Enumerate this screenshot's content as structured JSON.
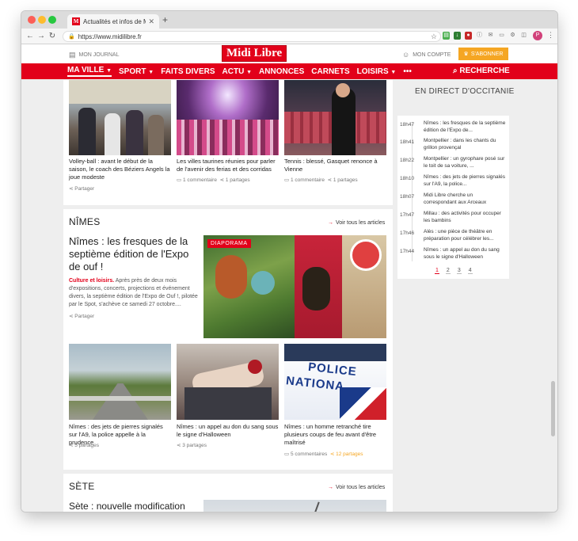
{
  "browser": {
    "tab_title": "Actualités et infos de Montpellier",
    "url": "https://www.midilibre.fr",
    "profile_initial": "P"
  },
  "header": {
    "mon_journal": "MON JOURNAL",
    "logo": "Midi Libre",
    "mon_compte": "MON COMPTE",
    "abonner": "S'ABONNER"
  },
  "nav": {
    "items": [
      "MA VILLE",
      "SPORT",
      "FAITS DIVERS",
      "ACTU",
      "ANNONCES",
      "CARNETS",
      "LOISIRS",
      "•••"
    ],
    "search": "RECHERCHE"
  },
  "top_articles": [
    {
      "title": "Volley-ball : avant le début de la saison, le coach des Béziers Angels la joue modeste",
      "share": "Partager"
    },
    {
      "title": "Les villes taurines réunies pour parler de l'avenir des ferias et des corridas",
      "comments": "1 commentaire",
      "shares": "1 partages"
    },
    {
      "title": "Tennis : blessé, Gasquet renonce à Vienne",
      "comments": "1 commentaire",
      "shares": "1 partages"
    }
  ],
  "nimes": {
    "section": "NÎMES",
    "voir": "Voir tous les articles",
    "lead_title": "Nîmes : les fresques de la septième édition de l'Expo de ouf !",
    "lead_category": "Culture et loisirs.",
    "lead_text": " Après près de deux mois d'expositions, concerts, projections et événement divers, la septième édition de l'Expo de Ouf !, pilotée par le Spot, s'achève ce samedi 27 octobre....",
    "lead_share": "Partager",
    "badge": "DIAPORAMA",
    "articles": [
      {
        "title": "Nîmes : des jets de pierres signalés sur l'A9, la police appelle à la prudence",
        "shares": "5 partages"
      },
      {
        "title": "Nîmes : un appel au don du sang sous le signe d'Halloween",
        "shares": "3 partages"
      },
      {
        "title": "Nîmes : un homme retranché tire plusieurs coups de feu avant d'être maîtrisé",
        "comments": "5 commentaires",
        "shares": "12 partages"
      }
    ]
  },
  "sete": {
    "section": "SÈTE",
    "voir": "Voir tous les articles",
    "lead_title": "Sète : nouvelle modification"
  },
  "sidebar": {
    "heading": "EN DIRECT D'OCCITANIE",
    "items": [
      {
        "time": "18h47",
        "text": "Nîmes : les fresques de la septième édition de l'Expo de..."
      },
      {
        "time": "18h41",
        "text": "Montpellier : dans les chants du grillon provençal"
      },
      {
        "time": "18h22",
        "text": "Montpellier : un gyrophare posé sur le toit de sa voiture, ..."
      },
      {
        "time": "18h10",
        "text": "Nîmes : des jets de pierres signalés sur l'A9, la police..."
      },
      {
        "time": "18h07",
        "text": "Midi Libre cherche un correspondant aux Arceaux"
      },
      {
        "time": "17h47",
        "text": "Millau : des activités pour occuper les bambins"
      },
      {
        "time": "17h46",
        "text": "Alès : une pièce de théâtre en préparation pour célébrer les..."
      },
      {
        "time": "17h44",
        "text": "Nîmes : un appel au don du sang sous le signe d'Halloween"
      }
    ],
    "pages": [
      "1",
      "2",
      "3",
      "4"
    ]
  },
  "colors": {
    "brand_red": "#e2001a",
    "subscribe_orange": "#f5a623"
  }
}
